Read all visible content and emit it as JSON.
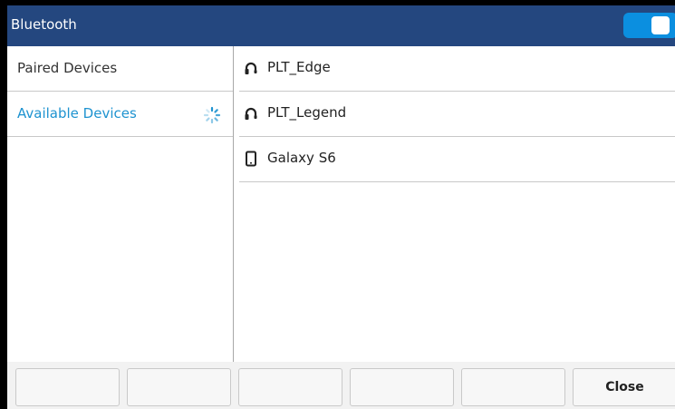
{
  "header": {
    "title": "Bluetooth",
    "toggle_on": true,
    "toggle_color": "#0b8fe0",
    "bar_color": "#24477f"
  },
  "sidebar": {
    "items": [
      {
        "label": "Paired Devices",
        "active": false
      },
      {
        "label": "Available Devices",
        "active": true,
        "loading": true
      }
    ],
    "active_color": "#1e93d0"
  },
  "devices": [
    {
      "label": "PLT_Edge",
      "icon": "headset-icon"
    },
    {
      "label": "PLT_Legend",
      "icon": "headset-icon"
    },
    {
      "label": "Galaxy S6",
      "icon": "phone-icon"
    }
  ],
  "softkeys": {
    "labels": [
      "",
      "",
      "",
      "",
      "",
      "Close"
    ]
  }
}
